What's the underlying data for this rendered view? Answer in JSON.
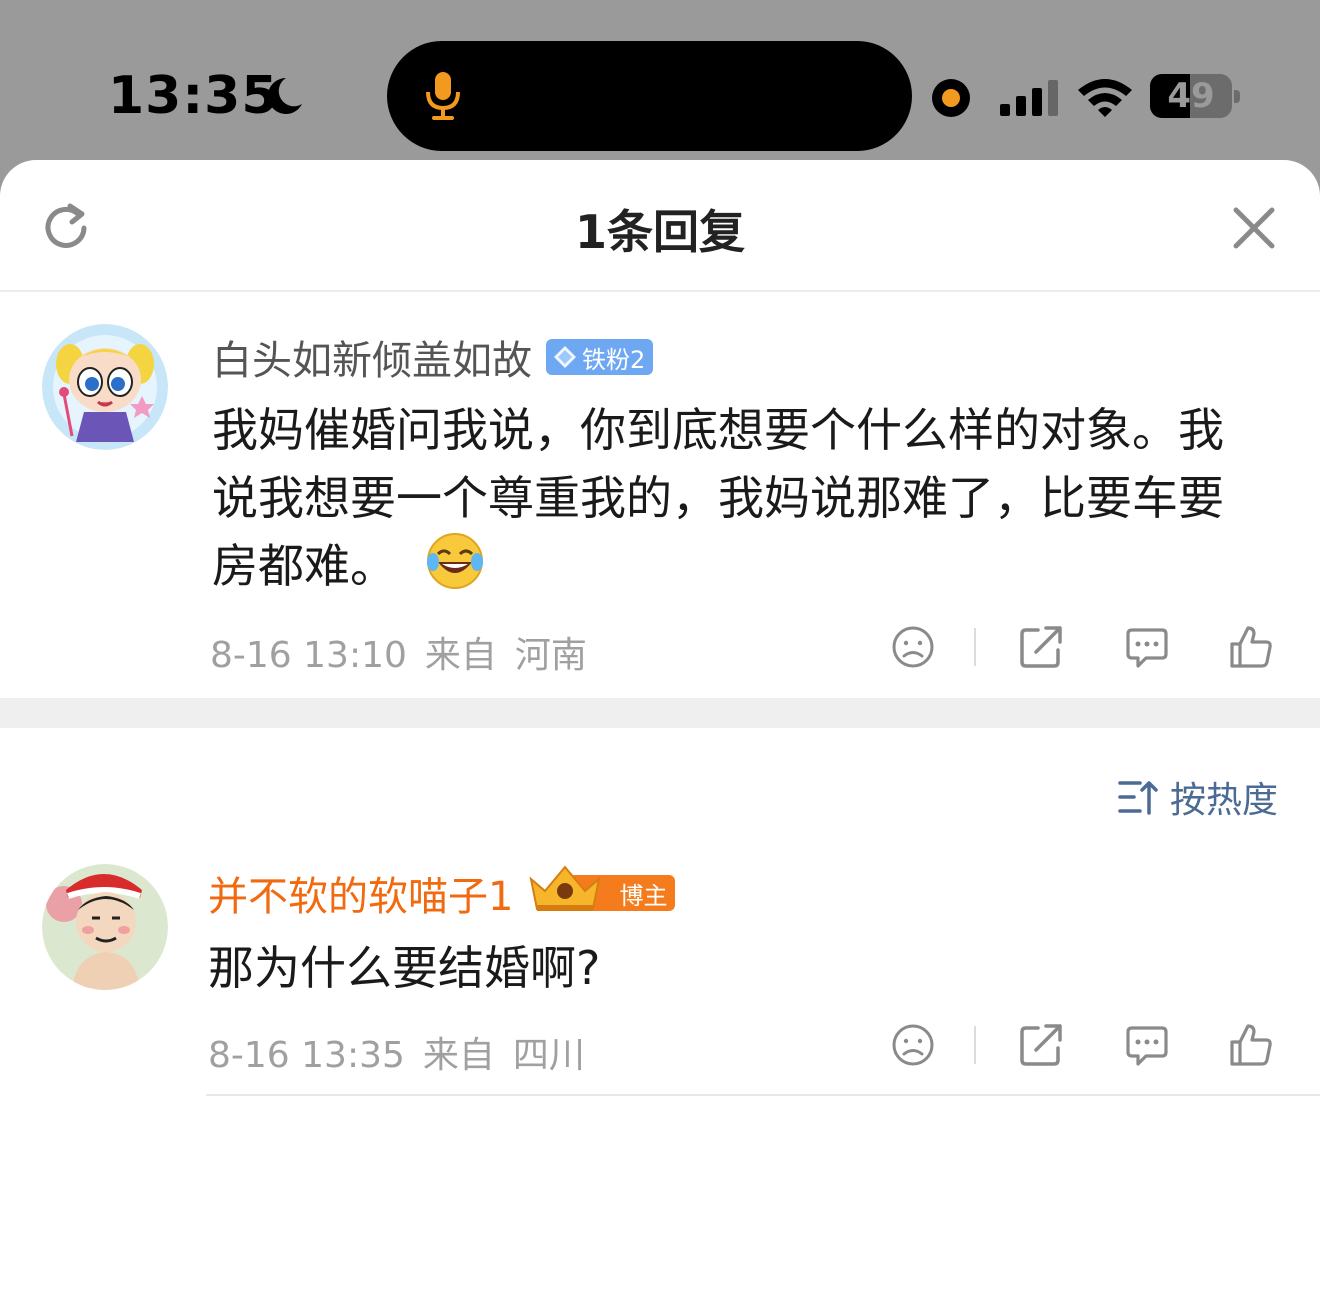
{
  "status_bar": {
    "time": "13:35",
    "battery": "49",
    "battery_level_percent": 49,
    "icons": [
      "moon-icon",
      "microphone-icon",
      "recording-dot-icon",
      "cellular-signal-icon",
      "wifi-icon",
      "battery-icon"
    ],
    "colors": {
      "mic": "#f39a1e",
      "recording_dot": "#f39a1e"
    }
  },
  "sheet": {
    "title": "1条回复",
    "icons": {
      "left": "refresh-icon",
      "right": "close-icon"
    }
  },
  "main_comment": {
    "username": "白头如新倾盖如故",
    "badge": "铁粉2",
    "text": "我妈催婚问我说，你到底想要个什么样的对象。我说我想要一个尊重我的，我妈说那难了，比要车要房都难。",
    "emoji": "laughing-crying-emoji",
    "date": "8-16 13:10",
    "from_label": "来自",
    "location": "河南",
    "colors": {
      "badge": "#6ea8f2"
    }
  },
  "sort": {
    "label": "按热度",
    "icon": "sort-icon"
  },
  "reply": {
    "username": "并不软的软喵子1",
    "badge": "博主",
    "text": "那为什么要结婚啊?",
    "date": "8-16 13:35",
    "from_label": "来自",
    "location": "四川",
    "colors": {
      "username": "#f26a0f",
      "badge": "#f47c1c"
    }
  },
  "actions": [
    "dislike-icon",
    "share-icon",
    "comment-icon",
    "like-icon"
  ]
}
